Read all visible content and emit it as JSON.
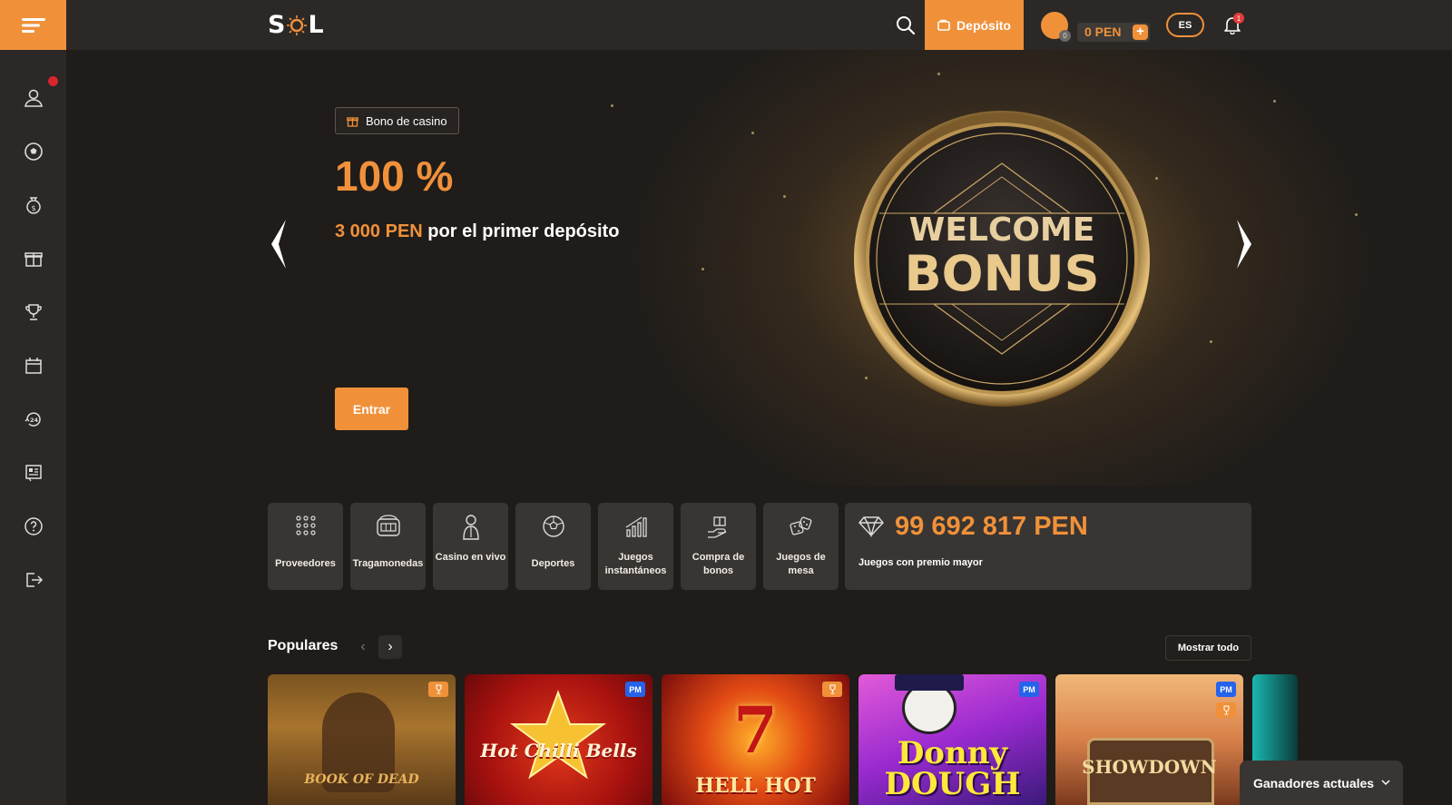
{
  "header": {
    "logo": "SOL",
    "deposit_label": "Depósito",
    "avatar_level": "0",
    "balance": "0 PEN",
    "balance_add": "+",
    "language": "ES",
    "notification_count": "1"
  },
  "sidebar": {
    "items": [
      "profile-icon",
      "sports-ball-icon",
      "money-bag-icon",
      "gift-icon",
      "trophy-icon",
      "calendar-icon",
      "support-24-icon",
      "news-icon",
      "help-icon",
      "logout-icon"
    ]
  },
  "hero": {
    "tag": "Bono de casino",
    "percent": "100 %",
    "amount": "3 000 PEN",
    "subtitle_rest": " por el primer depósito",
    "cta": "Entrar",
    "coin_line1": "WELCOME",
    "coin_line2": "BONUS"
  },
  "categories": [
    {
      "label": "Proveedores",
      "icon": "grid-dots-icon"
    },
    {
      "label": "Tragamonedas",
      "icon": "slot-machine-icon"
    },
    {
      "label": "Casino en vivo",
      "icon": "dealer-icon"
    },
    {
      "label": "Deportes",
      "icon": "soccer-ball-icon"
    },
    {
      "label": "Juegos instantáneos",
      "icon": "chart-rise-icon"
    },
    {
      "label": "Compra de bonos",
      "icon": "gift-hand-icon"
    },
    {
      "label": "Juegos de mesa",
      "icon": "dice-icon"
    }
  ],
  "jackpot": {
    "value": "99 692 817 PEN",
    "label": "Juegos con premio mayor"
  },
  "populares": {
    "title": "Populares",
    "show_all": "Mostrar todo",
    "games": [
      {
        "name": "BOOK OF DEAD",
        "tag": "trophy"
      },
      {
        "name": "Hot Chilli Bells",
        "tag": "pr"
      },
      {
        "name": "HELL HOT",
        "tag": "trophy"
      },
      {
        "name": "Donny DOUGH",
        "tag": "pr"
      },
      {
        "name": "SHOWDOWN",
        "tag": "pr"
      }
    ]
  },
  "winners_label": "Ganadores actuales",
  "colors": {
    "accent": "#f0913a",
    "panel": "#393532",
    "bg": "#1f1c1a",
    "bar": "#2b2826"
  }
}
